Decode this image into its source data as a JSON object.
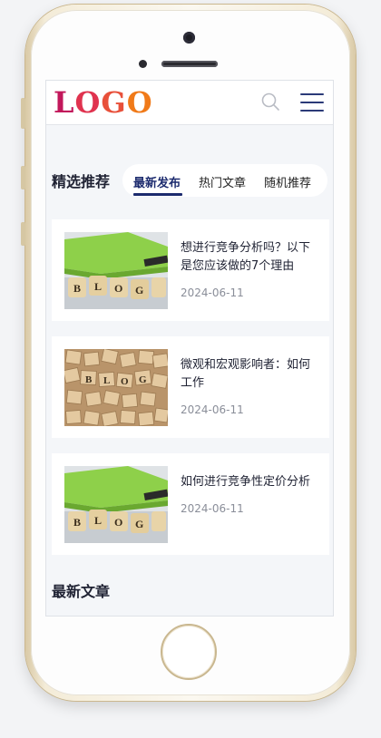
{
  "header": {
    "logo_letters": [
      "L",
      "O",
      "G",
      "O"
    ],
    "logo_colors": [
      "#c2185b",
      "#e05a2b",
      "#e23b5a",
      "#f07a19"
    ],
    "accent": "#1c2b6e"
  },
  "featured": {
    "title": "精选推荐",
    "tabs": [
      {
        "label": "最新发布",
        "active": true
      },
      {
        "label": "热门文章",
        "active": false
      },
      {
        "label": "随机推荐",
        "active": false
      }
    ]
  },
  "articles": [
    {
      "title": "想进行竞争分析吗？以下是您应该做的7个理由",
      "date": "2024-06-11",
      "thumb": "blog-blocks-green"
    },
    {
      "title": "微观和宏观影响者：如何工作",
      "date": "2024-06-11",
      "thumb": "blog-tiles-scattered"
    },
    {
      "title": "如何进行竞争性定价分析",
      "date": "2024-06-11",
      "thumb": "blog-blocks-green"
    }
  ],
  "latest": {
    "title": "最新文章"
  }
}
